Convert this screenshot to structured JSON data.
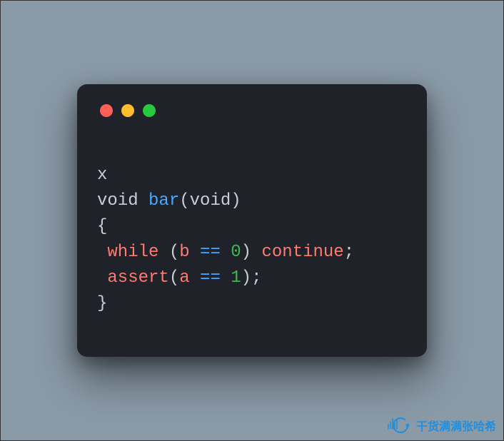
{
  "window": {
    "traffic_lights": {
      "red": "#ff5f56",
      "yellow": "#ffbd2e",
      "green": "#27c93f"
    },
    "background": "#1f2228"
  },
  "code": {
    "line1": {
      "text": "x"
    },
    "line2": {
      "type1": "void",
      "sp1": " ",
      "func": "bar",
      "lparen": "(",
      "type2": "void",
      "rparen": ")"
    },
    "line3": {
      "brace": "{"
    },
    "line4": {
      "indent": " ",
      "kw": "while",
      "sp1": " ",
      "lparen": "(",
      "ident": "b",
      "sp2": " ",
      "op": "==",
      "sp3": " ",
      "num": "0",
      "rparen": ")",
      "sp4": " ",
      "kw2": "continue",
      "semi": ";"
    },
    "line5": {
      "indent": " ",
      "func": "assert",
      "lparen": "(",
      "ident": "a",
      "sp1": " ",
      "op": "==",
      "sp2": " ",
      "num": "1",
      "rparen": ")",
      "semi": ";"
    },
    "line6": {
      "brace": "}"
    }
  },
  "watermark": {
    "text": "干货满满张哈希"
  }
}
